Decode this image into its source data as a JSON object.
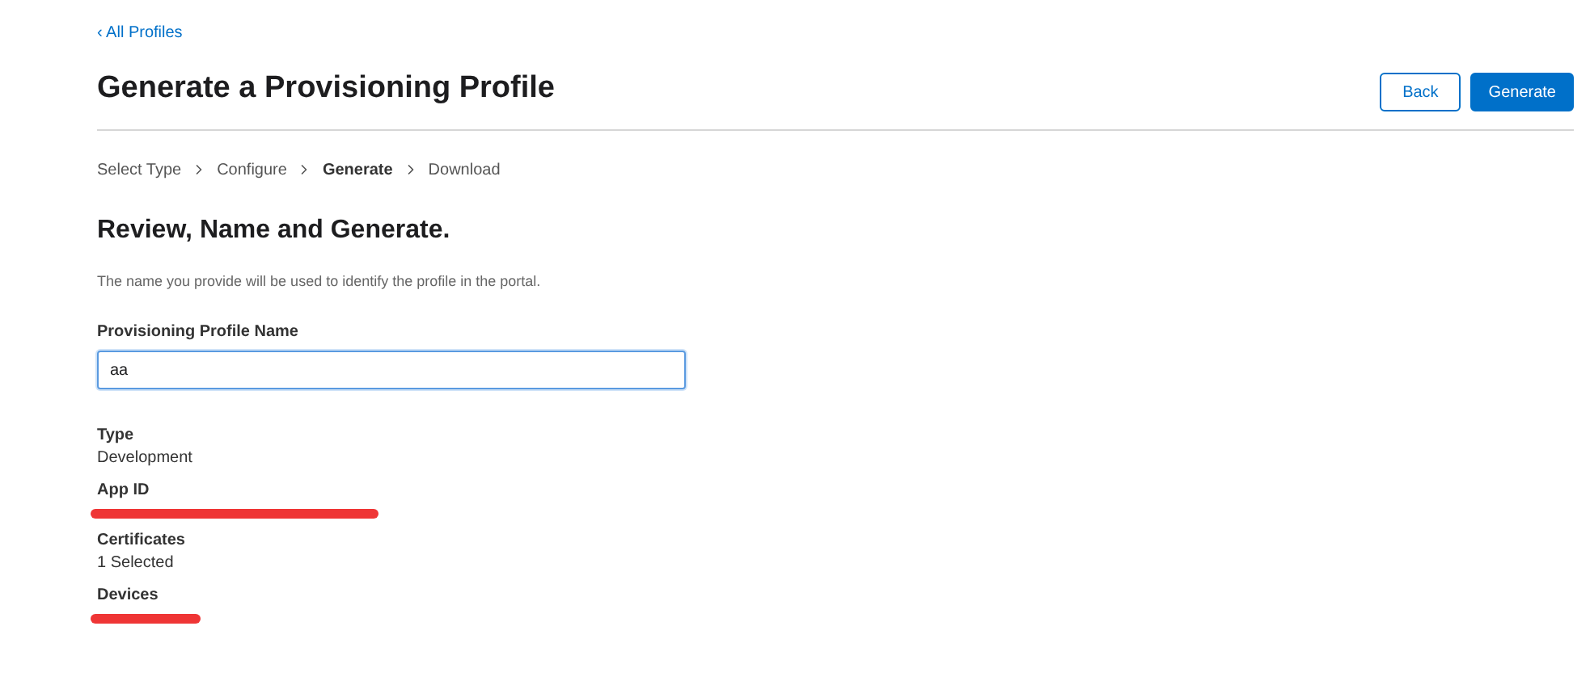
{
  "back_link": "‹ All Profiles",
  "title": "Generate a Provisioning Profile",
  "buttons": [
    {
      "label": "Back",
      "kind": "secondary"
    },
    {
      "label": "Generate",
      "kind": "primary"
    }
  ],
  "steps": [
    {
      "label": "Select Type",
      "selected": false
    },
    {
      "label": "Configure",
      "selected": false
    },
    {
      "label": "Generate",
      "selected": true
    },
    {
      "label": "Download",
      "selected": false
    }
  ],
  "heading": "Review, Name and Generate.",
  "description": "The name you provide will be used to identify the profile in the portal.",
  "name_field": {
    "label": "Provisioning Profile Name",
    "value": "aa"
  },
  "details": [
    {
      "label": "Type",
      "kind": "text",
      "value": "Development"
    },
    {
      "label": "App ID",
      "kind": "redacted"
    },
    {
      "label": "Certificates",
      "kind": "text",
      "value": "1 Selected"
    },
    {
      "label": "Devices",
      "kind": "blotted"
    }
  ]
}
